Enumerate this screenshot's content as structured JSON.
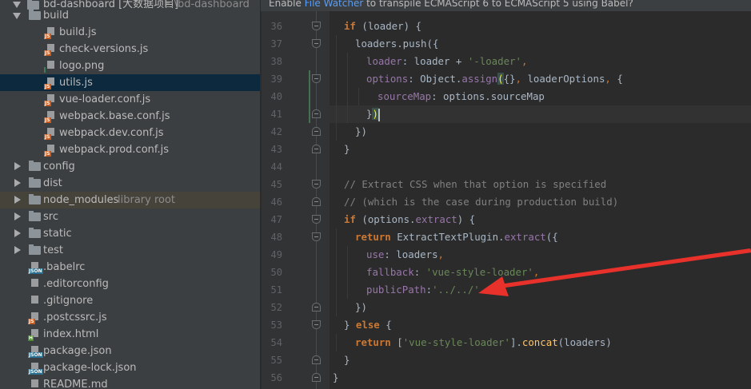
{
  "project_tree": {
    "root_label": "bd-dashboard [大数据项目]",
    "root_path": "E:\\bd-dashboard",
    "items": [
      {
        "label": "build",
        "type": "folder",
        "level": 1,
        "expanded": true
      },
      {
        "label": "build.js",
        "type": "js",
        "level": 2
      },
      {
        "label": "check-versions.js",
        "type": "js",
        "level": 2
      },
      {
        "label": "logo.png",
        "type": "png",
        "level": 2
      },
      {
        "label": "utils.js",
        "type": "js",
        "level": 2,
        "selected": true
      },
      {
        "label": "vue-loader.conf.js",
        "type": "js",
        "level": 2
      },
      {
        "label": "webpack.base.conf.js",
        "type": "js",
        "level": 2
      },
      {
        "label": "webpack.dev.conf.js",
        "type": "js",
        "level": 2
      },
      {
        "label": "webpack.prod.conf.js",
        "type": "js",
        "level": 2
      },
      {
        "label": "config",
        "type": "folder",
        "level": 1,
        "expanded": false
      },
      {
        "label": "dist",
        "type": "folder",
        "level": 1,
        "expanded": false
      },
      {
        "label": "node_modules",
        "type": "folder",
        "level": 1,
        "expanded": false,
        "suffix": "library root"
      },
      {
        "label": "src",
        "type": "folder",
        "level": 1,
        "expanded": false
      },
      {
        "label": "static",
        "type": "folder",
        "level": 1,
        "expanded": false
      },
      {
        "label": "test",
        "type": "folder",
        "level": 1,
        "expanded": false
      },
      {
        "label": ".babelrc",
        "type": "json",
        "level": 1
      },
      {
        "label": ".editorconfig",
        "type": "text",
        "level": 1
      },
      {
        "label": ".gitignore",
        "type": "text",
        "level": 1
      },
      {
        "label": ".postcssrc.js",
        "type": "js",
        "level": 1
      },
      {
        "label": "index.html",
        "type": "html",
        "level": 1
      },
      {
        "label": "package.json",
        "type": "json",
        "level": 1
      },
      {
        "label": "package-lock.json",
        "type": "json",
        "level": 1
      },
      {
        "label": "README.md",
        "type": "text",
        "level": 1
      }
    ]
  },
  "banner": {
    "prefix": "Enable ",
    "link": "File Watcher",
    "suffix": " to transpile ECMAScript 6 to ECMAScript 5 using Babel?"
  },
  "editor": {
    "current_line": 41,
    "lines": [
      {
        "n": "36",
        "indent": 1,
        "fold": "start",
        "seg": [
          [
            "if",
            "kw"
          ],
          [
            " (loader) {",
            ""
          ]
        ]
      },
      {
        "n": "37",
        "indent": 2,
        "fold": "start",
        "seg": [
          [
            "loaders.push({",
            ""
          ]
        ]
      },
      {
        "n": "38",
        "indent": 3,
        "seg": [
          [
            "loader",
            "prop"
          ],
          [
            ": loader + ",
            ""
          ],
          [
            "'-loader'",
            "str"
          ],
          [
            ",",
            "pn"
          ]
        ]
      },
      {
        "n": "39",
        "indent": 3,
        "fold": "start",
        "seg": [
          [
            "options",
            "prop"
          ],
          [
            ": Object.",
            ""
          ],
          [
            "assign",
            "prop"
          ],
          [
            "(",
            "brk"
          ],
          [
            "{}",
            ""
          ],
          [
            ", ",
            "pn"
          ],
          [
            "loaderOptions",
            ""
          ],
          [
            ", ",
            "pn"
          ],
          [
            "{",
            ""
          ]
        ]
      },
      {
        "n": "40",
        "indent": 4,
        "seg": [
          [
            "sourceMap",
            "prop"
          ],
          [
            ": options.sourceMap",
            ""
          ]
        ]
      },
      {
        "n": "41",
        "indent": 3,
        "fold": "end",
        "seg": [
          [
            "}",
            ""
          ],
          [
            ")",
            "brk"
          ]
        ],
        "caret": true
      },
      {
        "n": "42",
        "indent": 2,
        "fold": "end",
        "seg": [
          [
            "})",
            ""
          ]
        ]
      },
      {
        "n": "43",
        "indent": 1,
        "fold": "end",
        "seg": [
          [
            "}",
            ""
          ]
        ]
      },
      {
        "n": "44",
        "indent": 1,
        "seg": []
      },
      {
        "n": "45",
        "indent": 1,
        "fold": "start",
        "seg": [
          [
            "// Extract CSS when that option is specified",
            "cm"
          ]
        ]
      },
      {
        "n": "46",
        "indent": 1,
        "fold": "end",
        "seg": [
          [
            "// (which is the case during production build)",
            "cm"
          ]
        ]
      },
      {
        "n": "47",
        "indent": 1,
        "fold": "start",
        "seg": [
          [
            "if",
            "kw"
          ],
          [
            " (options.",
            ""
          ],
          [
            "extract",
            "prop"
          ],
          [
            ") {",
            ""
          ]
        ]
      },
      {
        "n": "48",
        "indent": 2,
        "fold": "start",
        "seg": [
          [
            "return",
            "kw"
          ],
          [
            " ExtractTextPlugin.",
            ""
          ],
          [
            "extract",
            "prop"
          ],
          [
            "({",
            ""
          ]
        ]
      },
      {
        "n": "49",
        "indent": 3,
        "seg": [
          [
            "use",
            "prop"
          ],
          [
            ": loaders",
            ""
          ],
          [
            ",",
            "pn"
          ]
        ]
      },
      {
        "n": "50",
        "indent": 3,
        "seg": [
          [
            "fallback",
            "prop"
          ],
          [
            ": ",
            ""
          ],
          [
            "'vue-style-loader'",
            "str"
          ],
          [
            ",",
            "pn"
          ]
        ]
      },
      {
        "n": "51",
        "indent": 3,
        "seg": [
          [
            "publicPath",
            "prop"
          ],
          [
            ":",
            ""
          ],
          [
            "'../../'",
            "str"
          ]
        ]
      },
      {
        "n": "52",
        "indent": 2,
        "fold": "end",
        "seg": [
          [
            "})",
            ""
          ]
        ]
      },
      {
        "n": "53",
        "indent": 1,
        "fold": "start",
        "seg": [
          [
            "} ",
            ""
          ],
          [
            "else",
            "kw"
          ],
          [
            " {",
            ""
          ]
        ]
      },
      {
        "n": "54",
        "indent": 2,
        "seg": [
          [
            "return",
            "kw"
          ],
          [
            " [",
            ""
          ],
          [
            "'vue-style-loader'",
            "str"
          ],
          [
            "].",
            ""
          ],
          [
            "concat",
            "fn"
          ],
          [
            "(loaders)",
            ""
          ]
        ]
      },
      {
        "n": "55",
        "indent": 1,
        "fold": "end",
        "seg": [
          [
            "}",
            ""
          ]
        ]
      },
      {
        "n": "56",
        "indent": 0,
        "fold": "end",
        "seg": [
          [
            "}",
            ""
          ]
        ]
      }
    ]
  },
  "annotation": {
    "type": "red-arrow",
    "color": "#e8312a",
    "points_to_line": "51"
  }
}
